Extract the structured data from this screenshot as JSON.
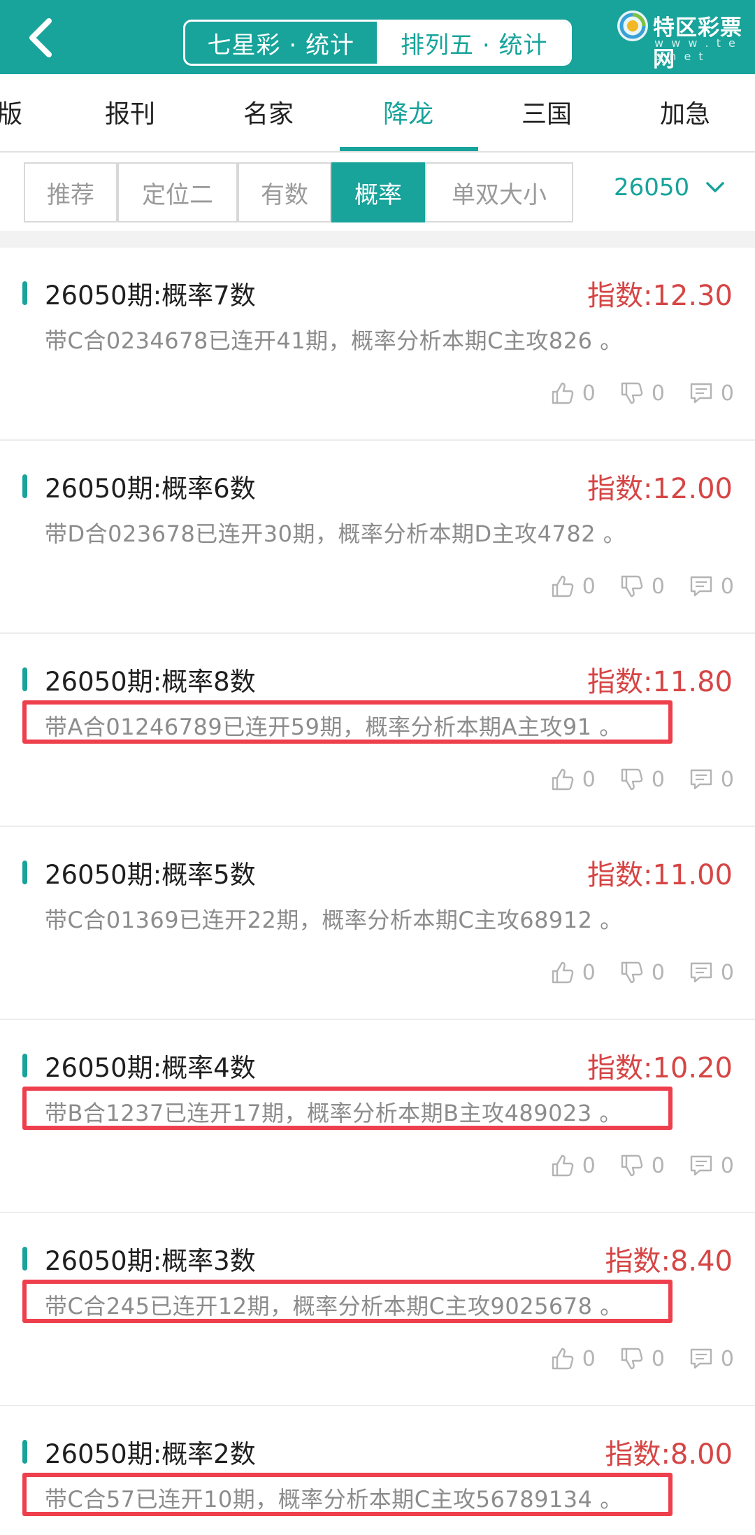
{
  "header": {
    "back_icon": "chevron-left-icon",
    "segments": [
      "七星彩 · 统计",
      "排列五 · 统计"
    ],
    "logo_text": "特区彩票网",
    "logo_sub": "w w w . t e q n e t",
    "colors": {
      "brand": "#18a39b",
      "accent_red": "#d64545",
      "highlight_box": "#ee3f4d"
    }
  },
  "tabs": [
    "版",
    "报刊",
    "名家",
    "降龙",
    "三国",
    "加急"
  ],
  "active_tab": "降龙",
  "filters": [
    "推荐",
    "定位二",
    "有数",
    "概率",
    "单双大小"
  ],
  "active_filter": "概率",
  "period_select": {
    "value": "26050",
    "icon": "chevron-down-icon"
  },
  "items": [
    {
      "title": "26050期:概率7数",
      "index": "指数:12.30",
      "desc": "带C合0234678已连开41期，概率分析本期C主攻826 。",
      "highlighted": false,
      "likes": "0",
      "dislikes": "0",
      "comments": "0"
    },
    {
      "title": "26050期:概率6数",
      "index": "指数:12.00",
      "desc": "带D合023678已连开30期，概率分析本期D主攻4782 。",
      "highlighted": false,
      "likes": "0",
      "dislikes": "0",
      "comments": "0"
    },
    {
      "title": "26050期:概率8数",
      "index": "指数:11.80",
      "desc": "带A合01246789已连开59期，概率分析本期A主攻91 。",
      "highlighted": true,
      "likes": "0",
      "dislikes": "0",
      "comments": "0"
    },
    {
      "title": "26050期:概率5数",
      "index": "指数:11.00",
      "desc": "带C合01369已连开22期，概率分析本期C主攻68912 。",
      "highlighted": false,
      "likes": "0",
      "dislikes": "0",
      "comments": "0"
    },
    {
      "title": "26050期:概率4数",
      "index": "指数:10.20",
      "desc": "带B合1237已连开17期，概率分析本期B主攻489023 。",
      "highlighted": true,
      "likes": "0",
      "dislikes": "0",
      "comments": "0"
    },
    {
      "title": "26050期:概率3数",
      "index": "指数:8.40",
      "desc": "带C合245已连开12期，概率分析本期C主攻9025678 。",
      "highlighted": true,
      "likes": "0",
      "dislikes": "0",
      "comments": "0"
    },
    {
      "title": "26050期:概率2数",
      "index": "指数:8.00",
      "desc": "带C合57已连开10期，概率分析本期C主攻56789134 。",
      "highlighted": true,
      "likes": "0",
      "dislikes": "0",
      "comments": "0"
    }
  ]
}
